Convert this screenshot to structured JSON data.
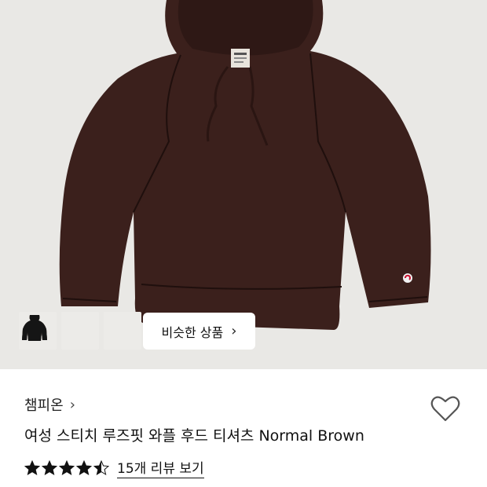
{
  "product": {
    "brand": "챔피온",
    "title": "여성 스티치 루즈핏 와플 후드 티셔츠 Normal Brown",
    "rating": 4.5,
    "rating_max": 5,
    "reviews_label": "15개 리뷰 보기"
  },
  "similar_button": {
    "label": "비슷한 상품"
  },
  "thumbnails": [
    {
      "name": "black",
      "color": "#141414"
    },
    {
      "name": "brown",
      "color": "#7a6252"
    },
    {
      "name": "black-alt",
      "color": "#151515"
    }
  ],
  "colors": {
    "hero_bg": "#e9e8e5",
    "garment": "#3b201c",
    "star": "#111111",
    "heart_stroke": "#555555"
  },
  "icons": {
    "brand_chevron": "chevron-right-icon",
    "similar_chevron": "chevron-right-icon",
    "wishlist": "heart-outline-icon",
    "rating": "star-icon"
  }
}
